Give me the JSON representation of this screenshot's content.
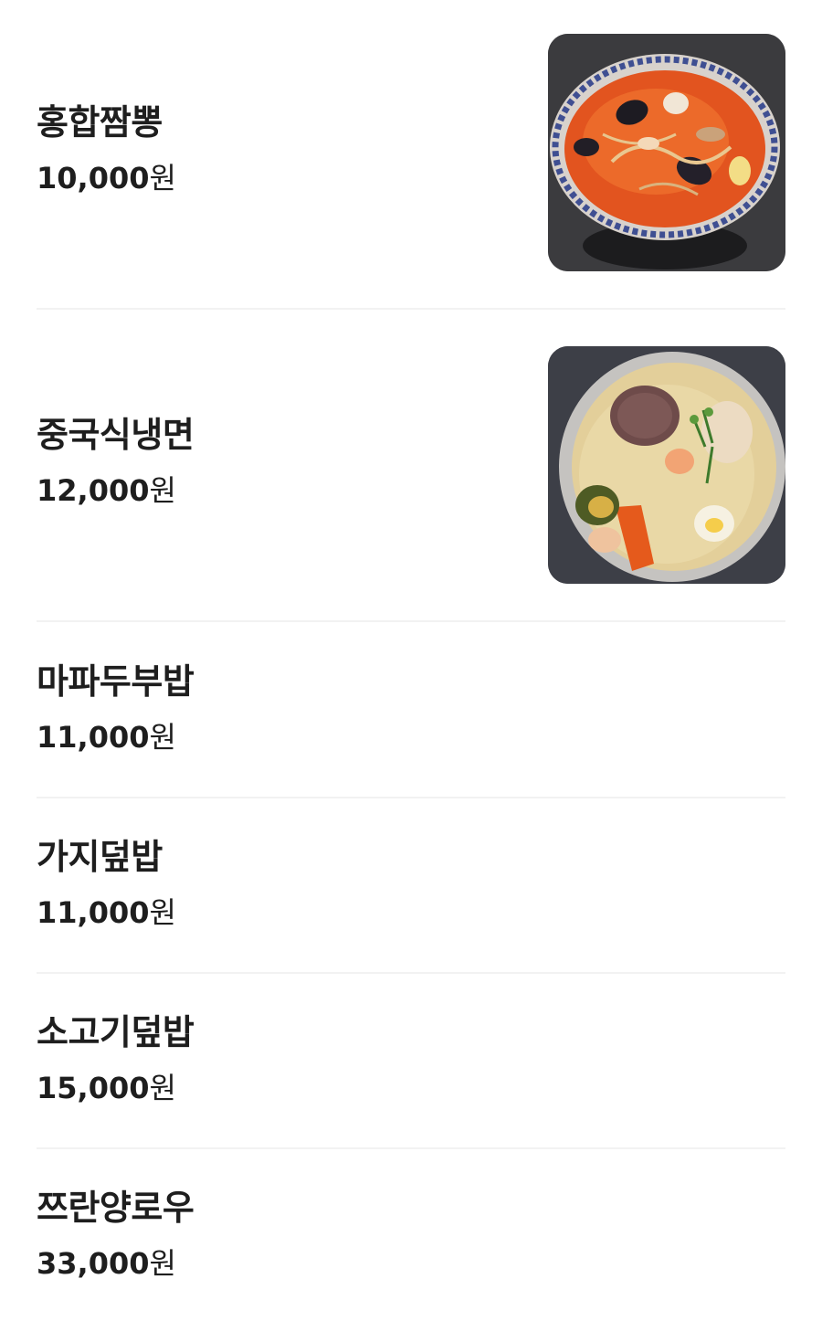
{
  "menu": {
    "items": [
      {
        "name": "홍합짬뽕",
        "price": "10,000",
        "currency": "원",
        "has_image": true,
        "image_icon": "jjamppong-bowl-image"
      },
      {
        "name": "중국식냉면",
        "price": "12,000",
        "currency": "원",
        "has_image": true,
        "image_icon": "cold-noodle-bowl-image"
      },
      {
        "name": "마파두부밥",
        "price": "11,000",
        "currency": "원",
        "has_image": false
      },
      {
        "name": "가지덮밥",
        "price": "11,000",
        "currency": "원",
        "has_image": false
      },
      {
        "name": "소고기덮밥",
        "price": "15,000",
        "currency": "원",
        "has_image": false
      },
      {
        "name": "쯔란양로우",
        "price": "33,000",
        "currency": "원",
        "has_image": false
      }
    ]
  },
  "colors": {
    "text": "#1e1e1e",
    "divider": "#f2f2f2",
    "background": "#ffffff"
  }
}
